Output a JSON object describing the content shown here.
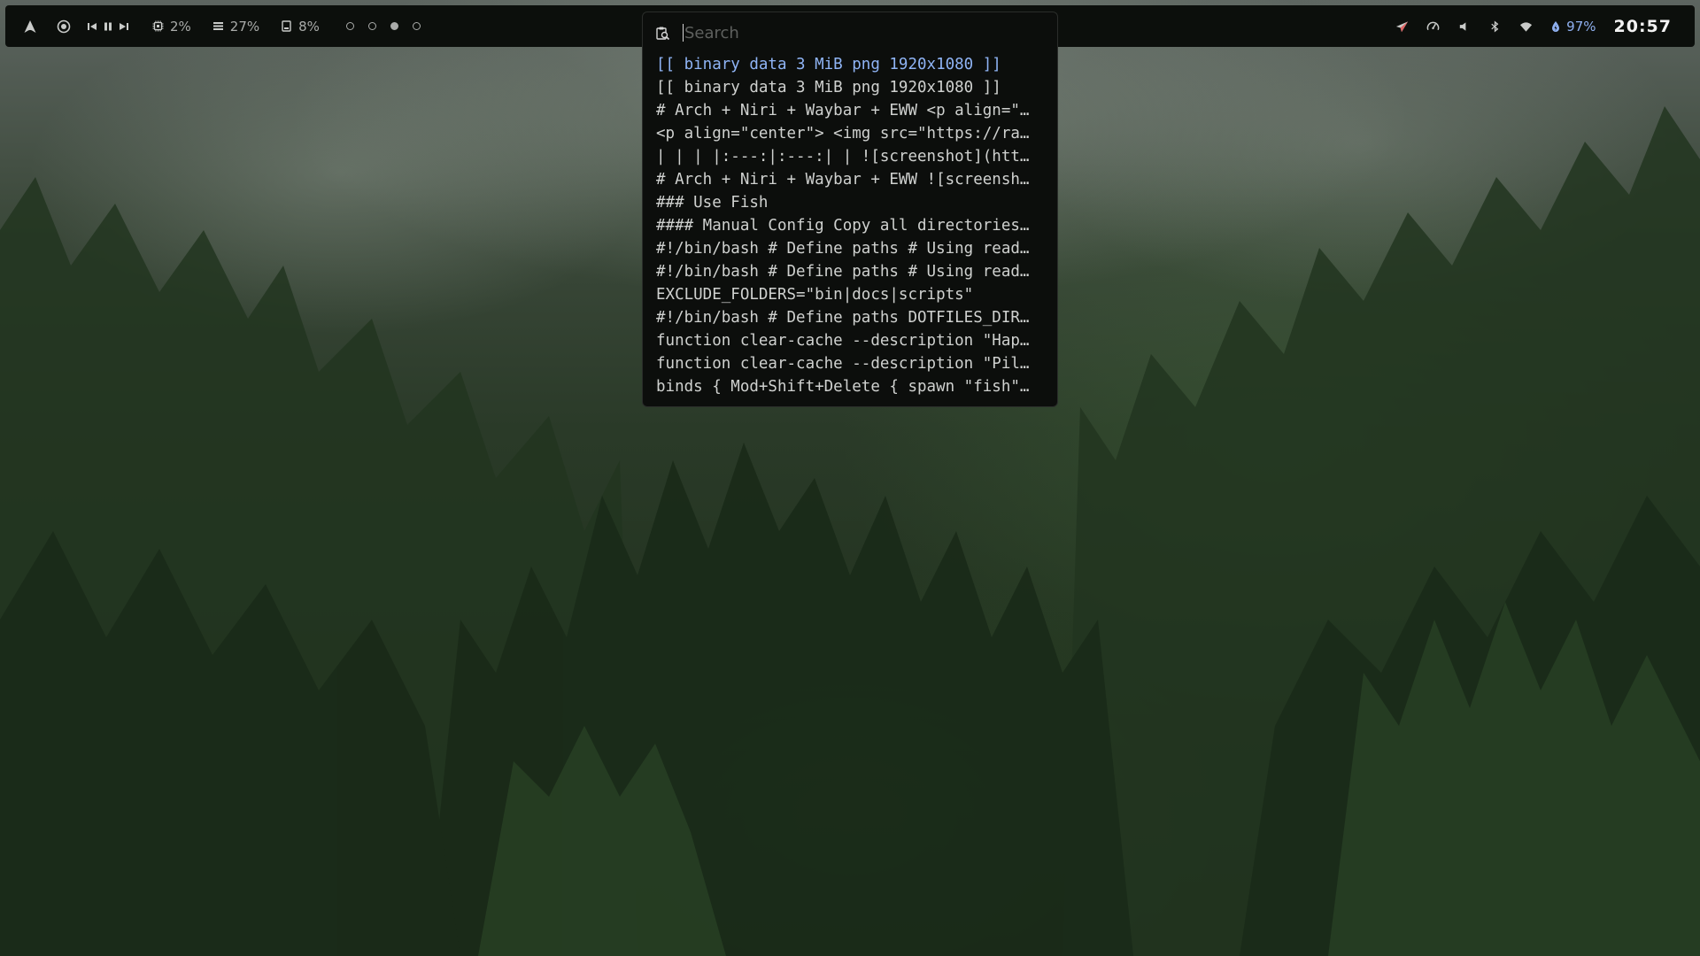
{
  "topbar": {
    "left": {
      "launcher_icon": "arch-logo-icon",
      "media_icon": "music-disc-icon",
      "media_controls": [
        "previous-icon",
        "pause-icon",
        "next-icon"
      ],
      "cpu": {
        "icon": "cpu-icon",
        "value": "2%"
      },
      "memory": {
        "icon": "memory-icon",
        "value": "27%"
      },
      "disk": {
        "icon": "disk-icon",
        "value": "8%"
      },
      "workspaces": [
        {
          "active": false
        },
        {
          "active": false
        },
        {
          "active": true
        },
        {
          "active": false
        }
      ]
    },
    "right": {
      "tray_icons": [
        "send-icon",
        "speedometer-icon",
        "volume-icon",
        "bluetooth-icon",
        "wifi-icon"
      ],
      "battery": {
        "icon": "battery-charging-icon",
        "value": "97%"
      },
      "clock": "20:57"
    },
    "colors": {
      "bar_bg": "#0c0f0c",
      "text": "#a9aba9",
      "accent": "#8fb0f0",
      "clock": "#f2f2f2"
    }
  },
  "launcher": {
    "icon": "clipboard-search-icon",
    "search": {
      "placeholder": "Search",
      "value": ""
    },
    "selected_index": 0,
    "items": [
      "[[ binary data 3 MiB png 1920x1080 ]]",
      "[[ binary data 3 MiB png 1920x1080 ]]",
      "# Arch + Niri + Waybar + EWW <p align=\"…",
      "<p align=\"center\"> <img src=\"https://ra…",
      "| | | |:---:|:---:| | ![screenshot](htt…",
      "# Arch + Niri + Waybar + EWW ![screensh…",
      "### Use Fish",
      "#### Manual Config Copy all directories…",
      "#!/bin/bash # Define paths # Using read…",
      "#!/bin/bash # Define paths # Using read…",
      "EXCLUDE_FOLDERS=\"bin|docs|scripts\"",
      "#!/bin/bash # Define paths DOTFILES_DIR…",
      "function clear-cache --description \"Hap…",
      "function clear-cache --description \"Pil…",
      "binds { Mod+Shift+Delete { spawn \"fish\"…"
    ],
    "colors": {
      "bg": "#0c0e0c",
      "text": "#cfd1cf",
      "selected": "#8fb4f5",
      "placeholder": "#5e605e"
    }
  }
}
